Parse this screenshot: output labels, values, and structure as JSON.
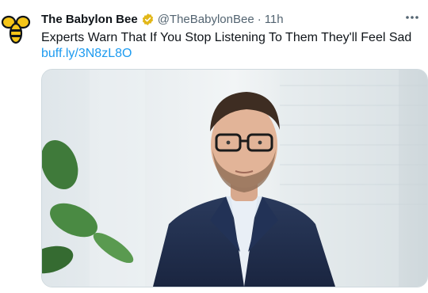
{
  "tweet": {
    "author_name": "The Babylon Bee",
    "author_handle": "@TheBabylonBee",
    "separator": "·",
    "time": "11h",
    "text": "Experts Warn That If You Stop Listening To Them They'll Feel Sad",
    "link": "buff.ly/3N8zL8O"
  },
  "icons": {
    "avatar": "babylon-bee-logo",
    "verified": "verified-badge-icon",
    "more": "more-options-icon"
  },
  "colors": {
    "link": "#1d9bf0",
    "secondary_text": "#536471",
    "verified_badge": "#e2b719",
    "bee_logo": "#f5c518"
  },
  "media": {
    "description_icon": "photo-man-in-suit-with-glasses"
  }
}
